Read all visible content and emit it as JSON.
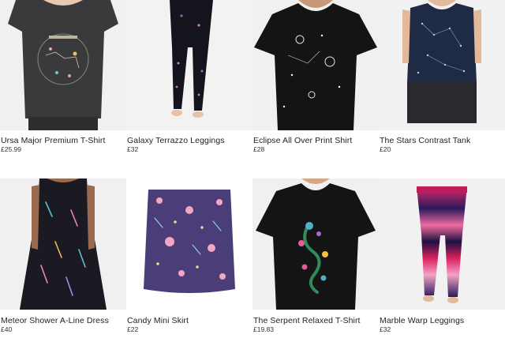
{
  "products": [
    {
      "name": "Ursa Major Premium T-Shirt",
      "price": "£25.99",
      "image": "ursa-major-tshirt-image"
    },
    {
      "name": "Galaxy Terrazzo Leggings",
      "price": "£32",
      "image": "galaxy-leggings-image"
    },
    {
      "name": "Eclipse All Over Print Shirt",
      "price": "£28",
      "image": "eclipse-shirt-image"
    },
    {
      "name": "The Stars Contrast Tank",
      "price": "£20",
      "image": "stars-tank-image"
    },
    {
      "name": "Meteor Shower A-Line Dress",
      "price": "£40",
      "image": "meteor-dress-image"
    },
    {
      "name": "Candy Mini Skirt",
      "price": "£22",
      "image": "candy-skirt-image"
    },
    {
      "name": "The Serpent Relaxed T-Shirt",
      "price": "£19.83",
      "image": "serpent-tshirt-image"
    },
    {
      "name": "Marble Warp Leggings",
      "price": "£32",
      "image": "marble-leggings-image"
    }
  ],
  "colors": {
    "background": "#ffffff",
    "text": "#222222",
    "photo_bg": "#efefef"
  }
}
